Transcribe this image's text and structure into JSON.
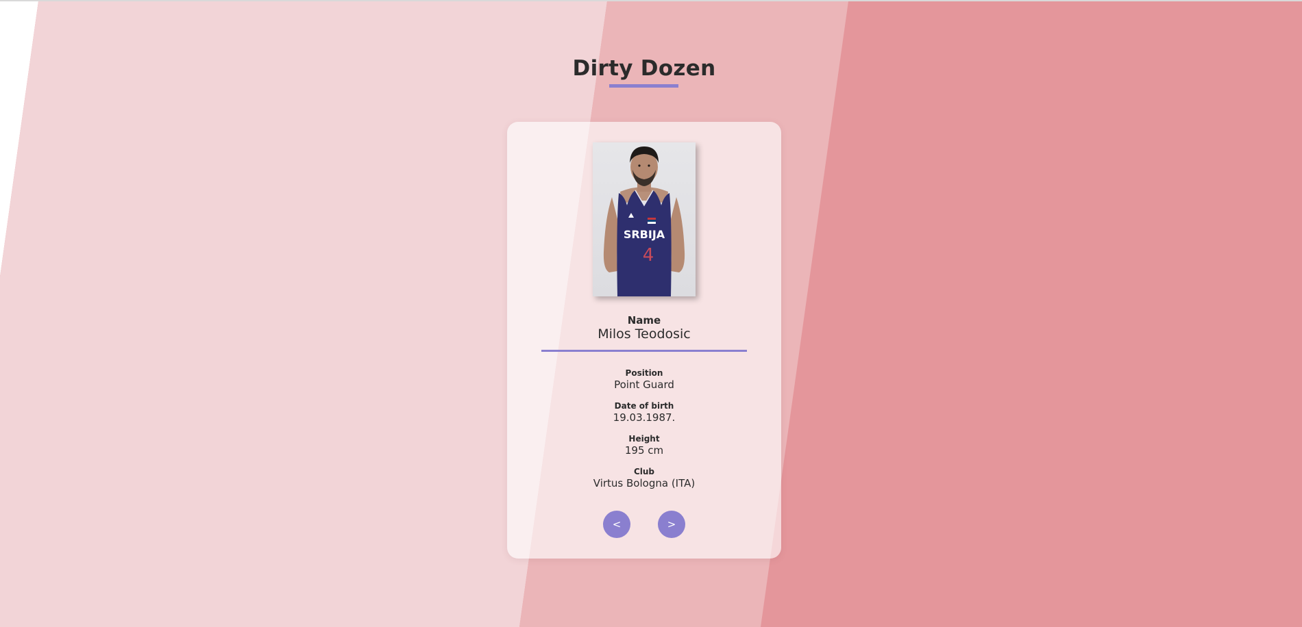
{
  "app": {
    "title": "Dirty Dozen"
  },
  "colors": {
    "accent": "#8a7fcf",
    "background_dark": "#e4969b",
    "background_mid": "#ebb5b8",
    "background_light": "#f2d4d7",
    "jersey": "#2e2f6e",
    "jersey_number": "#c84a5a"
  },
  "player": {
    "photo": {
      "jersey_text": "SRBIJA",
      "jersey_number": "4"
    },
    "name_label": "Name",
    "name": "Milos Teodosic",
    "fields": [
      {
        "label": "Position",
        "value": "Point Guard"
      },
      {
        "label": "Date of birth",
        "value": "19.03.1987."
      },
      {
        "label": "Height",
        "value": "195 cm"
      },
      {
        "label": "Club",
        "value": "Virtus Bologna (ITA)"
      }
    ]
  },
  "navigation": {
    "prev_label": "<",
    "next_label": ">"
  }
}
